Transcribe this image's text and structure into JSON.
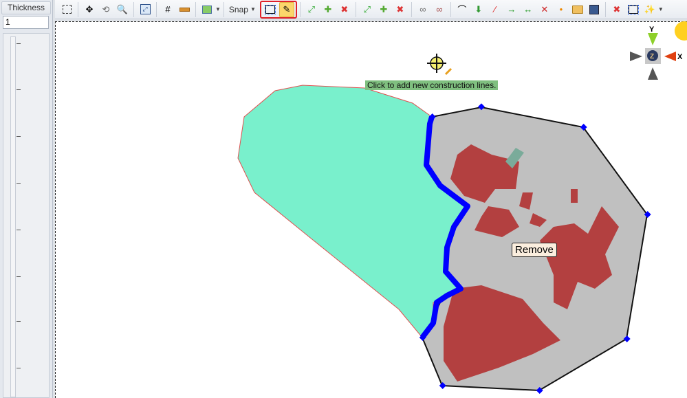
{
  "left_panel": {
    "thickness_label": "Thickness",
    "thickness_value": "1"
  },
  "toolbar": {
    "items": [
      "select-box",
      "pan",
      "orbit",
      "zoom",
      "zoom-extents",
      "grid",
      "ruler",
      "image",
      "snap",
      "construction-rect",
      "construction-pencil",
      "add-point-extend",
      "add-point",
      "delete-point",
      "extend-line",
      "add-line",
      "delete-line",
      "link",
      "unlink",
      "curve-line",
      "project-line",
      "cut-line",
      "arrow-line",
      "double-arrow-line",
      "cross-line",
      "split-line",
      "open-folder",
      "save",
      "delete-all",
      "select-rect",
      "magic-wand"
    ],
    "snap_label": "Snap"
  },
  "viewport": {
    "tooltip": "Click to add new construction lines.",
    "context_label": "Remove",
    "axes": {
      "y": "Y",
      "x": "X",
      "z": "Z"
    }
  },
  "colors": {
    "accent_highlight": "#e0202a",
    "region_green": "#79f0cc",
    "region_gray": "#c0c0c0",
    "river": "#0000ff",
    "patches": "#b34040"
  }
}
